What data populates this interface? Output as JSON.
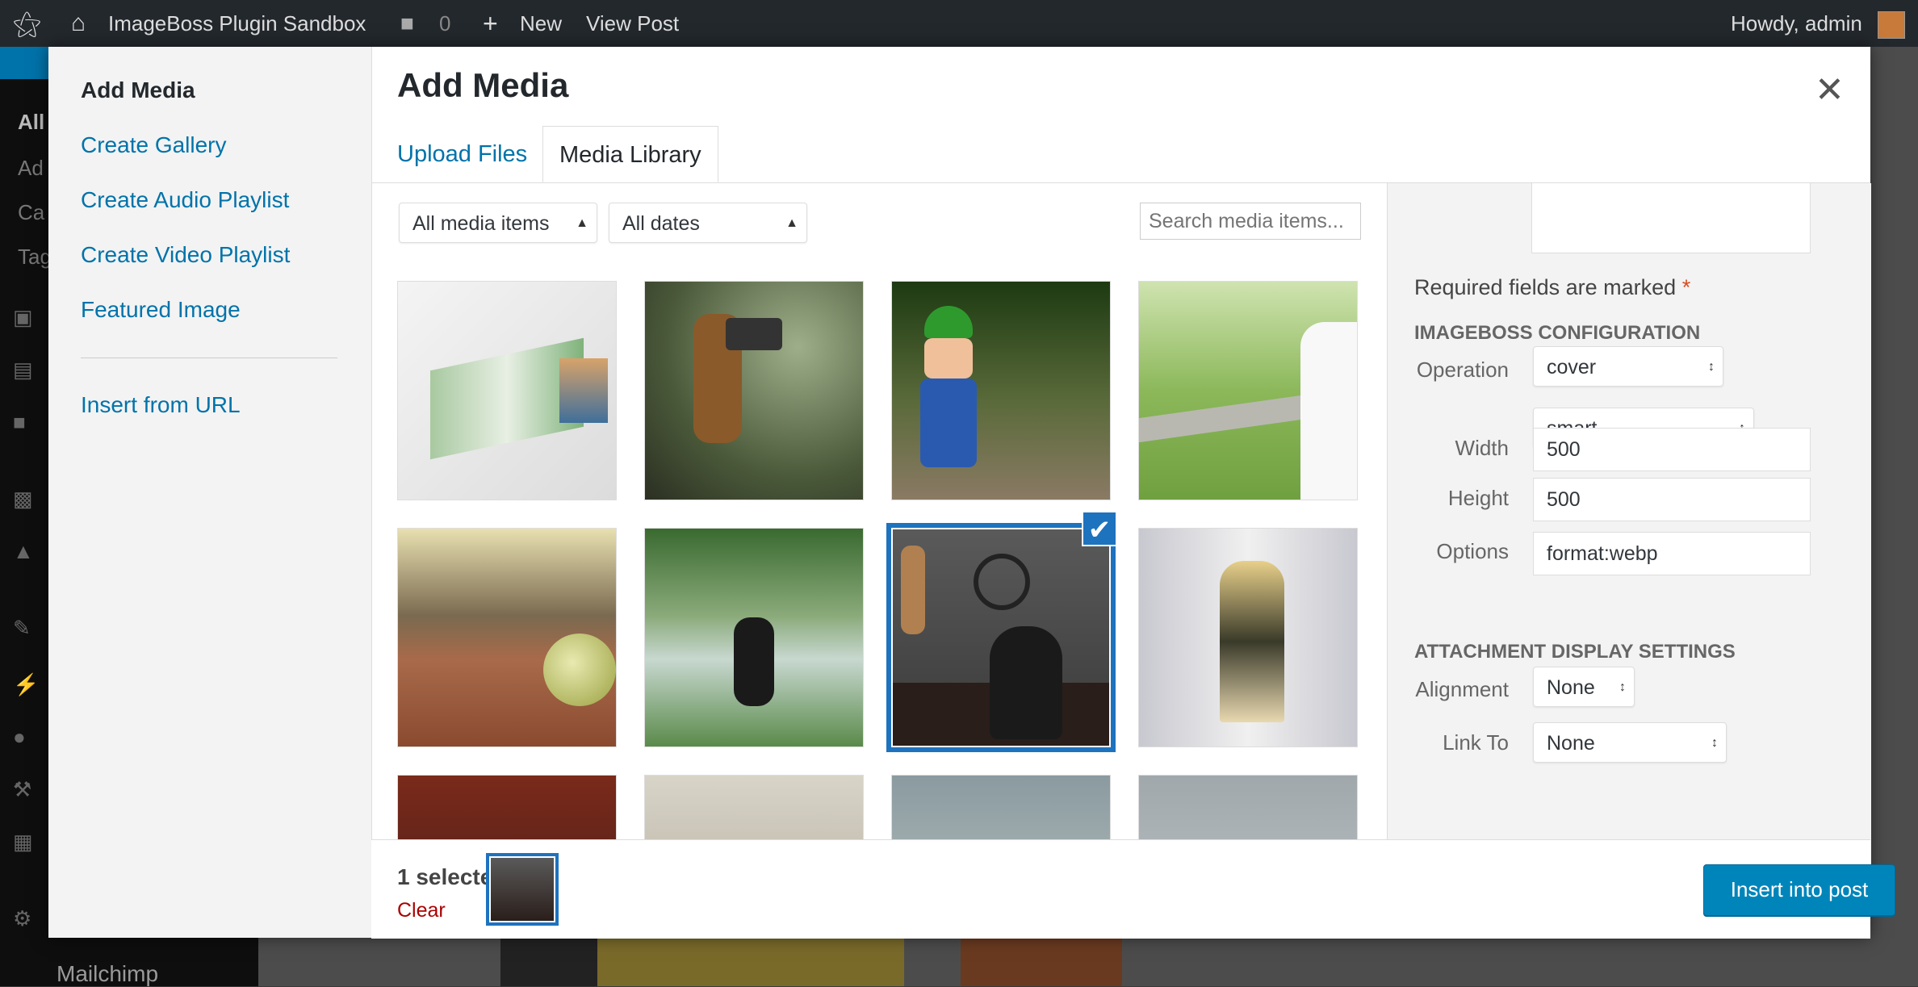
{
  "adminbar": {
    "site_name": "ImageBoss Plugin Sandbox",
    "comments_count": "0",
    "new_label": "New",
    "view_post_label": "View Post",
    "howdy": "Howdy, admin"
  },
  "sidebar": {
    "items": [
      "All",
      "Ad",
      "Ca",
      "Tag"
    ],
    "mailchimp": "Mailchimp"
  },
  "modal": {
    "title": "Add Media",
    "close_icon": "close-icon",
    "menu": {
      "active": "Add Media",
      "items": [
        "Create Gallery",
        "Create Audio Playlist",
        "Create Video Playlist",
        "Featured Image"
      ],
      "insert_url": "Insert from URL"
    },
    "tabs": [
      "Upload Files",
      "Media Library"
    ],
    "toolbar": {
      "filter_type": "All media items",
      "filter_date": "All dates",
      "search_placeholder": "Search media items..."
    },
    "grid": {
      "items": [
        {
          "desc": "tissue box"
        },
        {
          "desc": "toy camera figure"
        },
        {
          "desc": "plumber toy"
        },
        {
          "desc": "bride in park"
        },
        {
          "desc": "tennis ball"
        },
        {
          "desc": "couple by lake"
        },
        {
          "desc": "man with clock",
          "selected": true
        },
        {
          "desc": "fashion model"
        },
        {
          "desc": "portrait"
        },
        {
          "desc": "woman"
        },
        {
          "desc": "sky"
        },
        {
          "desc": "gray"
        }
      ]
    },
    "details": {
      "required_note": "Required fields are marked",
      "required_star": "*",
      "imageboss_heading": "IMAGEBOSS CONFIGURATION",
      "operation_label": "Operation",
      "operation_value": "cover",
      "mode_value": "smart",
      "width_label": "Width",
      "width_value": "500",
      "height_label": "Height",
      "height_value": "500",
      "options_label": "Options",
      "options_value": "format:webp",
      "display_heading": "ATTACHMENT DISPLAY SETTINGS",
      "alignment_label": "Alignment",
      "alignment_value": "None",
      "link_label": "Link To",
      "link_value": "None"
    },
    "bottom": {
      "selected_count": "1 selected",
      "clear_label": "Clear",
      "insert_label": "Insert into post"
    }
  },
  "colors": {
    "accent": "#0073aa",
    "primary_button": "#0085ba",
    "selection": "#1e73be",
    "clear": "#a00"
  }
}
